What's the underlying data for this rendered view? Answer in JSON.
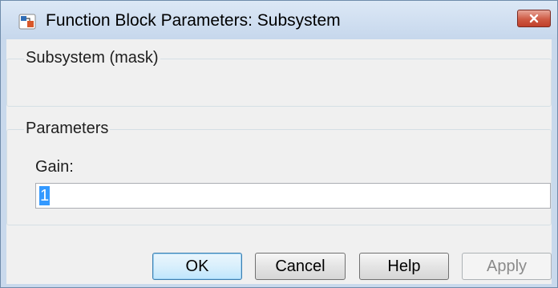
{
  "window": {
    "title": "Function Block Parameters: Subsystem",
    "icon": "simulink-block-icon",
    "close_icon": "close-icon"
  },
  "mask_group": {
    "title": "Subsystem (mask)"
  },
  "parameters_group": {
    "title": "Parameters",
    "gain_label": "Gain:",
    "gain_value": "1"
  },
  "buttons": {
    "ok": "OK",
    "cancel": "Cancel",
    "help": "Help",
    "apply": "Apply"
  },
  "colors": {
    "titlebar": "#c6d7ec",
    "close": "#c0402b",
    "selection": "#3399ff",
    "dialog_bg": "#f0f0f0"
  }
}
